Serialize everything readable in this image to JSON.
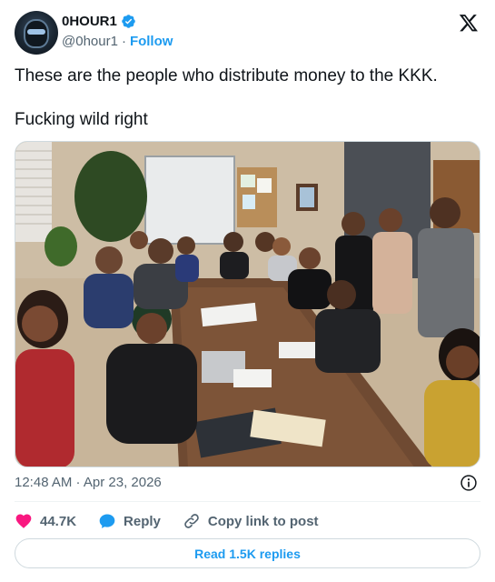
{
  "author": {
    "display_name": "0HOUR1",
    "handle": "@0hour1",
    "separator": "·",
    "follow_label": "Follow",
    "verified": true
  },
  "tweet": {
    "lines": [
      "These are the people who distribute money to the KKK.",
      "Fucking wild right"
    ]
  },
  "media": {
    "type": "photo"
  },
  "meta": {
    "timestamp": "12:48 AM · Apr 23, 2026"
  },
  "actions": {
    "likes_count": "44.7K",
    "reply_label": "Reply",
    "copy_label": "Copy link to post"
  },
  "read_replies_label": "Read 1.5K replies",
  "icons": {
    "brand": "x-logo-icon",
    "verified": "verified-badge-icon",
    "info": "info-icon",
    "like": "heart-icon",
    "reply": "reply-bubble-icon",
    "copy": "link-icon"
  },
  "colors": {
    "accent": "#1d9bf0",
    "like": "#f91880",
    "secondary_text": "#536471",
    "text": "#0f1419",
    "border": "#cfd9de"
  }
}
